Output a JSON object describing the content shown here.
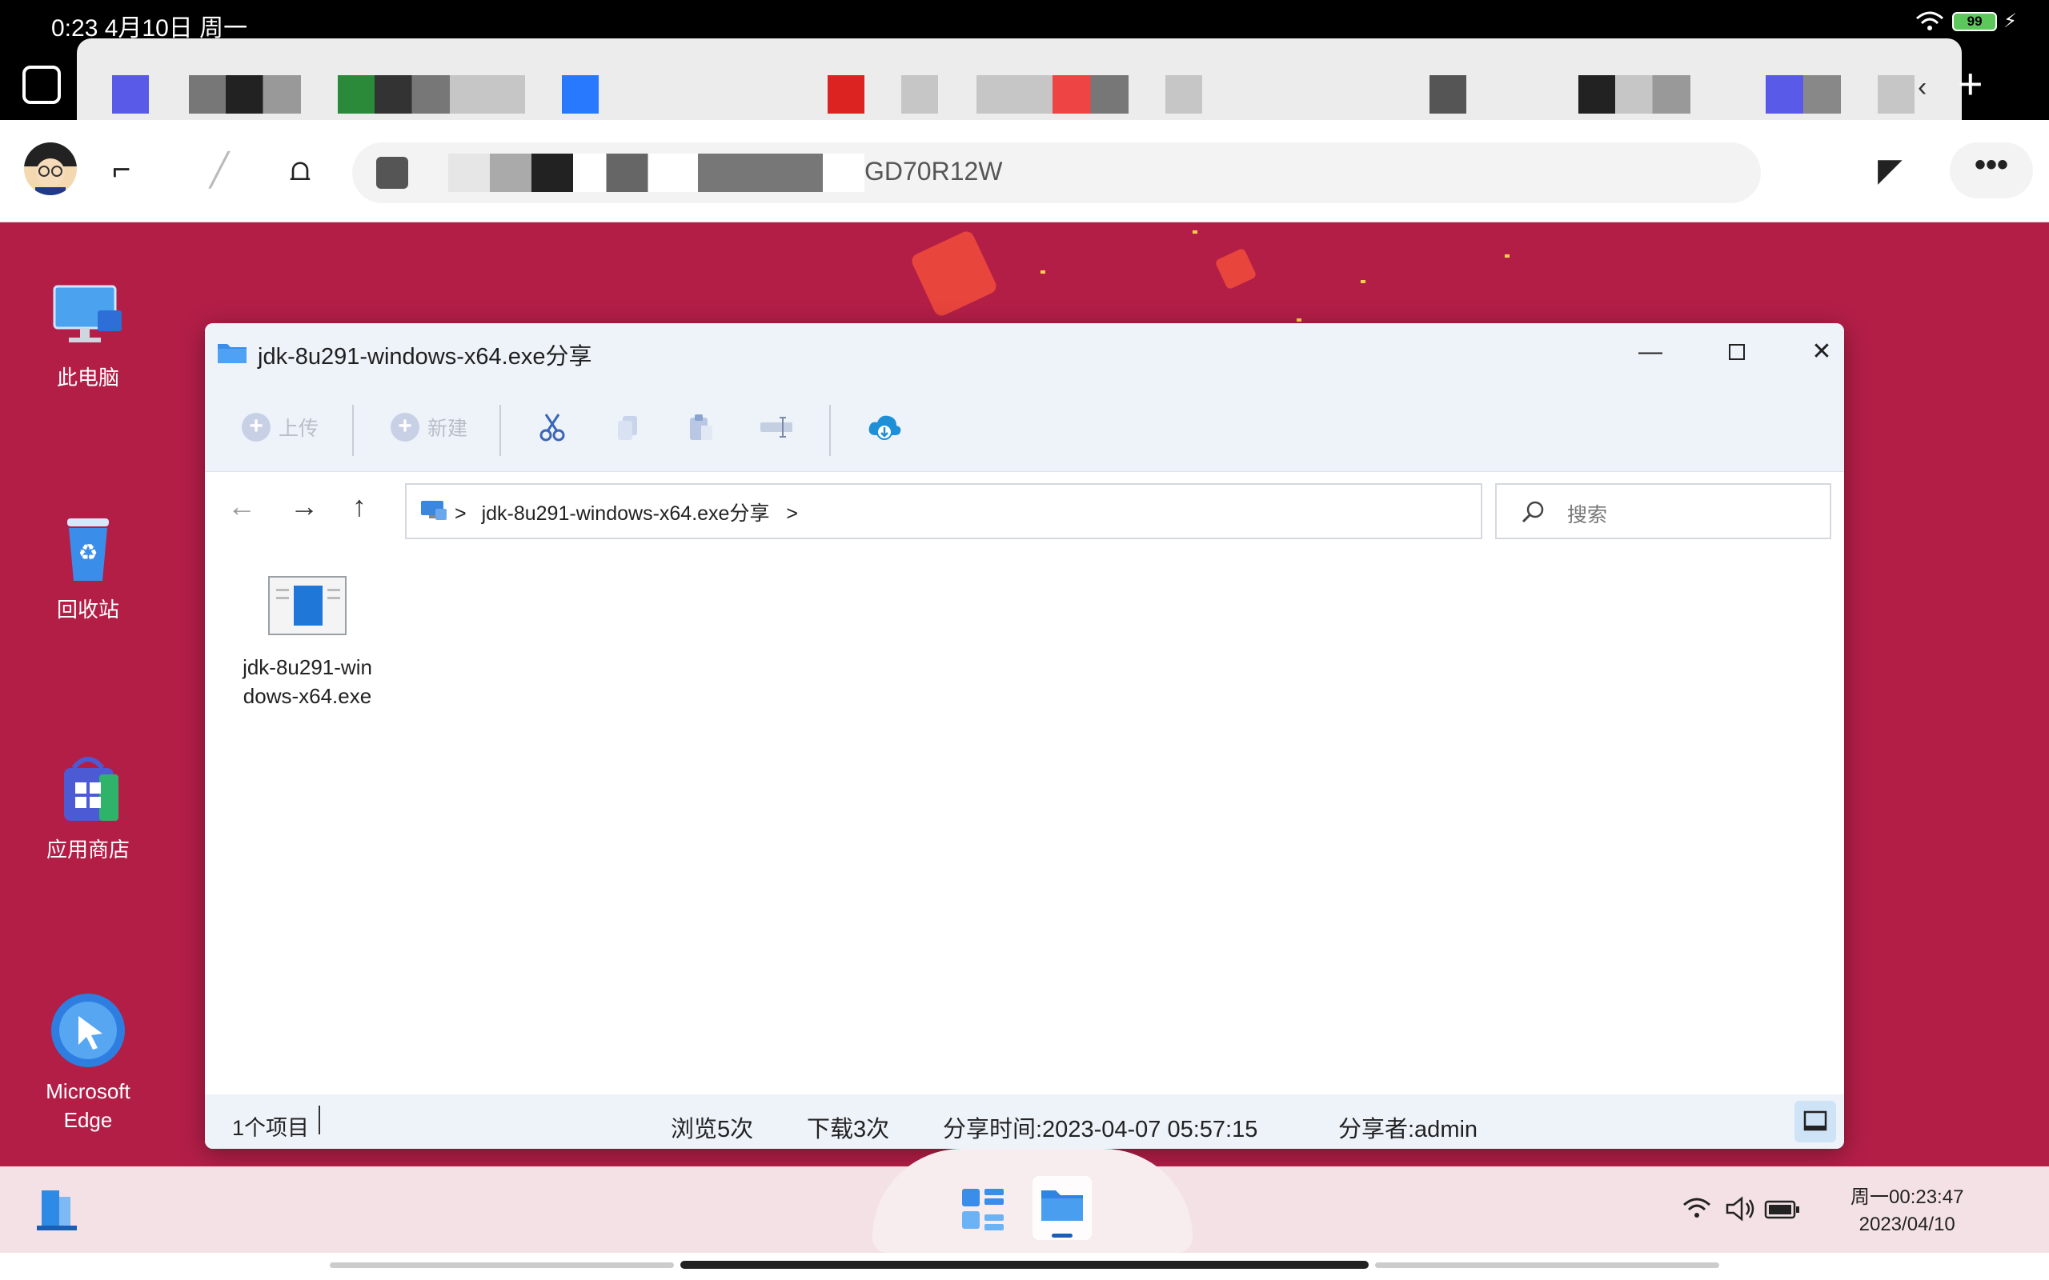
{
  "status_bar": {
    "time_text": "0:23 4月10日 周一",
    "battery": "99"
  },
  "browser": {
    "address_text": "GD70R12W",
    "more_label": "•••",
    "new_tab_label": "+"
  },
  "desktop": {
    "icons": [
      {
        "label": "此电脑"
      },
      {
        "label": "回收站"
      },
      {
        "label": "应用商店"
      },
      {
        "label": "Microsoft Edge"
      }
    ],
    "wallpaper_color": "#b31e47"
  },
  "window": {
    "title": "jdk-8u291-windows-x64.exe分享",
    "ribbon": {
      "upload_label": "上传",
      "new_label": "新建"
    },
    "breadcrumb": {
      "separator": ">",
      "item": "jdk-8u291-windows-x64.exe分享",
      "trailing": ">"
    },
    "search_placeholder": "搜索",
    "files": [
      {
        "name": "jdk-8u291-windows-x64.exe"
      }
    ],
    "status": {
      "count": "1个项目",
      "views": "浏览5次",
      "downloads": "下载3次",
      "share_time": "分享时间:2023-04-07 05:57:15",
      "sharer": "分享者:admin"
    }
  },
  "taskbar": {
    "clock_line1": "周一00:23:47",
    "clock_line2": "2023/04/10"
  },
  "colors": {
    "accent": "#1a73e8",
    "window_chrome": "#eef3fa",
    "taskbar": "#f4e1e6"
  }
}
